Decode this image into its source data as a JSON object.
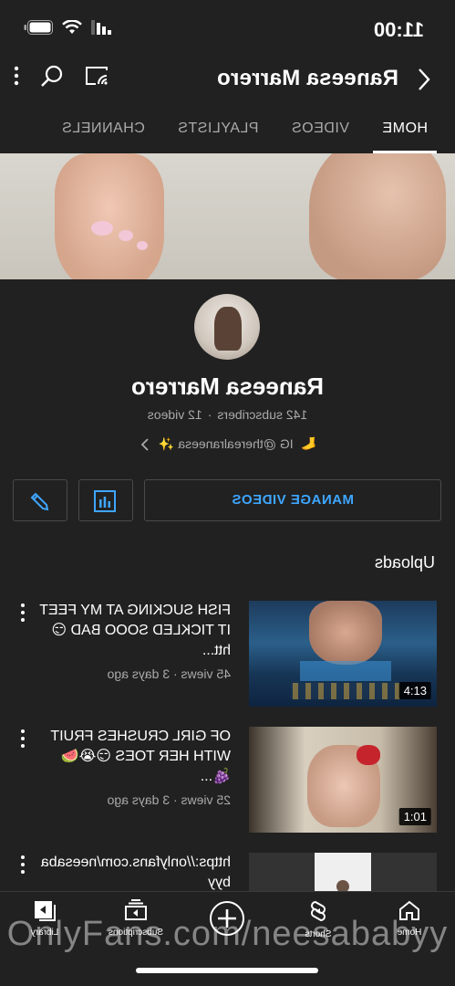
{
  "status": {
    "time": "11:00"
  },
  "appbar": {
    "title": "Raneesa Marrero"
  },
  "tabs": [
    {
      "label": "HOME"
    },
    {
      "label": "VIDEOS"
    },
    {
      "label": "PLAYLISTS"
    },
    {
      "label": "CHANNELS"
    }
  ],
  "profile": {
    "name": "Raneesa Marrero",
    "subscribers": "142 subscribers",
    "videos": "12 videos",
    "link_text": "IG @therealraneesa ✨"
  },
  "actions": {
    "manage_label": "MANAGE VIDEOS"
  },
  "section": {
    "title": "Uploads"
  },
  "uploads": [
    {
      "title": "FISH SUCKING AT MY FEET IT TICKLED SOOO BAD 😏 htt...",
      "meta": "45 views · 3 days ago",
      "duration": "4:13"
    },
    {
      "title": "OF GIRL CRUSHES FRUIT WITH HER TOES 😏😭🍉🍇...",
      "meta": "25 views · 3 days ago",
      "duration": "1:01"
    },
    {
      "title": "https://onlyfans.com/neesababyy",
      "meta": "",
      "duration": ""
    }
  ],
  "nav": [
    {
      "label": "Home"
    },
    {
      "label": "Shorts"
    },
    {
      "label": ""
    },
    {
      "label": "Subscriptions"
    },
    {
      "label": "Library"
    }
  ],
  "watermark": "OnlyFans.com/neesababyy"
}
